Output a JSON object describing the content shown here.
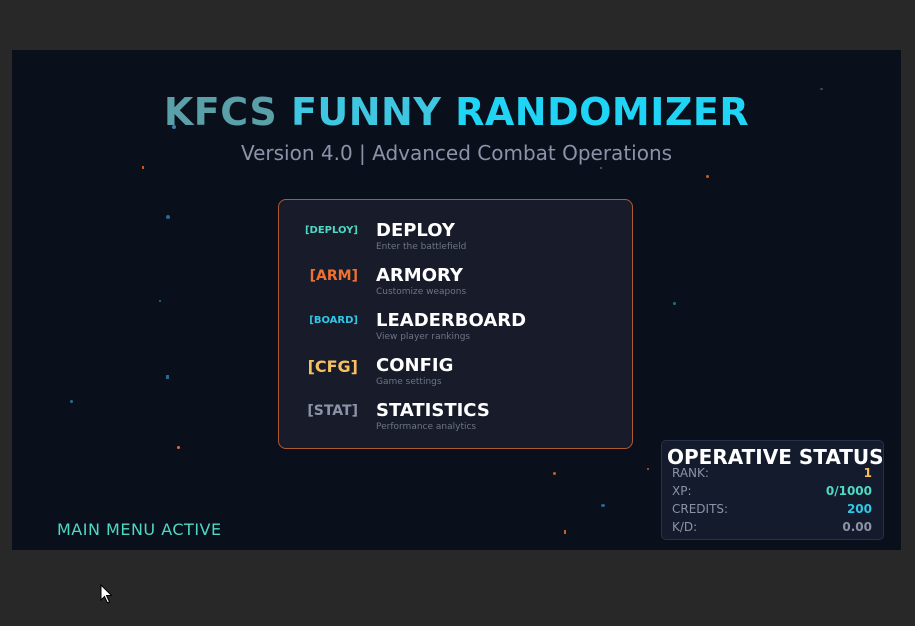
{
  "title": {
    "part1": "KFCS ",
    "part2": "FUNNY ",
    "part3": "RANDOMIZER"
  },
  "subtitle": "Version 4.0 | Advanced Combat Operations",
  "menu": {
    "items": [
      {
        "tag": "[DEPLOY]",
        "label": "DEPLOY",
        "desc": "Enter the battlefield",
        "tag_color": "#4fd8c4"
      },
      {
        "tag": "[ARM]",
        "label": "ARMORY",
        "desc": "Customize weapons",
        "tag_color": "#f07030"
      },
      {
        "tag": "[BOARD]",
        "label": "LEADERBOARD",
        "desc": "View player rankings",
        "tag_color": "#30c8e8"
      },
      {
        "tag": "[CFG]",
        "label": "CONFIG",
        "desc": "Game settings",
        "tag_color": "#f4c060"
      },
      {
        "tag": "[STAT]",
        "label": "STATISTICS",
        "desc": "Performance analytics",
        "tag_color": "#8c93a8"
      }
    ]
  },
  "status_text": "MAIN MENU ACTIVE",
  "operative_status": {
    "title": "OPERATIVE STATUS",
    "rows": [
      {
        "label": "RANK:",
        "value": "1",
        "color": "#f4c060"
      },
      {
        "label": "XP:",
        "value": "0/1000",
        "color": "#4fd8c4"
      },
      {
        "label": "CREDITS:",
        "value": "200",
        "color": "#30c8e8"
      },
      {
        "label": "K/D:",
        "value": "0.00",
        "color": "#8c93a8"
      }
    ]
  },
  "colors": {
    "background": "#0a0f1c",
    "accent_border": "#b0582e",
    "accent_cyan": "#1fd4f4"
  },
  "icons": {
    "cursor": "mouse-pointer-icon"
  }
}
